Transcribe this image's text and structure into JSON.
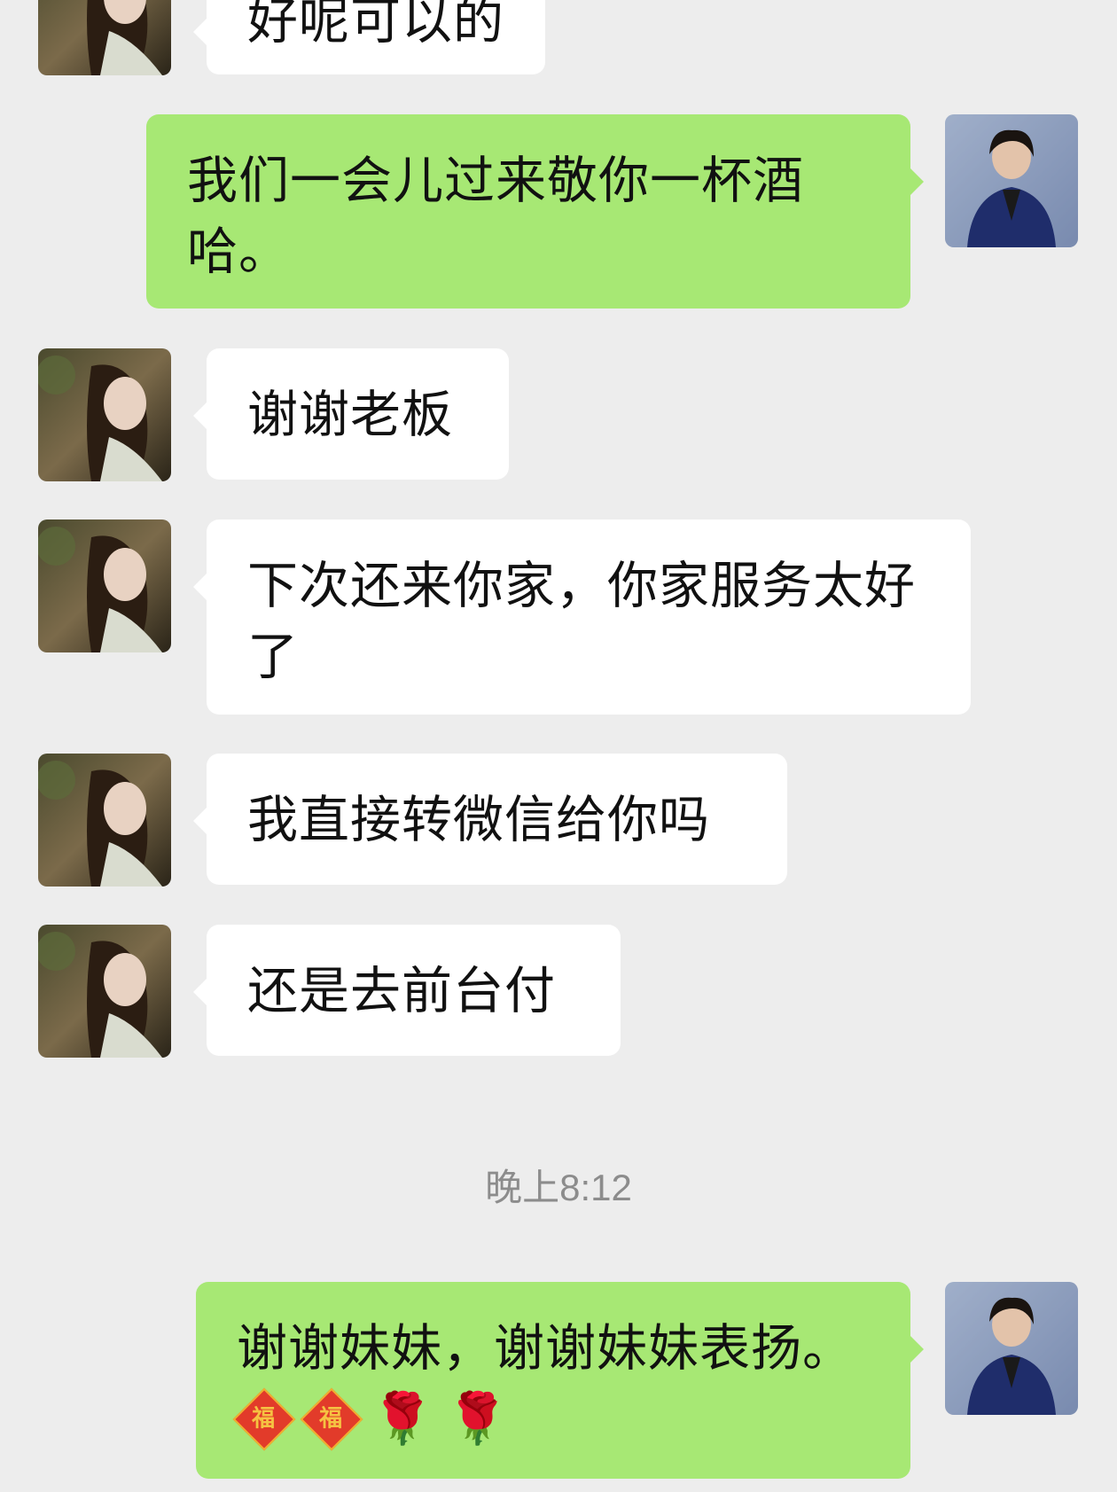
{
  "messages": [
    {
      "side": "in",
      "text": "好呢可以的"
    },
    {
      "side": "out",
      "text": "我们一会儿过来敬你一杯酒哈。"
    },
    {
      "side": "in",
      "text": "谢谢老板"
    },
    {
      "side": "in",
      "text": "下次还来你家，你家服务太好了"
    },
    {
      "side": "in",
      "text": "我直接转微信给你吗"
    },
    {
      "side": "in",
      "text": "还是去前台付"
    },
    {
      "side": "out",
      "text": "谢谢妹妹，谢谢妹妹表扬。"
    }
  ],
  "timestamp": "晚上8:12",
  "emoji": {
    "fu_char": "福",
    "rose_char": "🌹",
    "names": [
      "fu-emoji",
      "fu-emoji",
      "rose-emoji",
      "rose-emoji"
    ]
  },
  "colors": {
    "background": "#ededed",
    "incoming_bubble": "#ffffff",
    "outgoing_bubble": "#a7e874"
  }
}
